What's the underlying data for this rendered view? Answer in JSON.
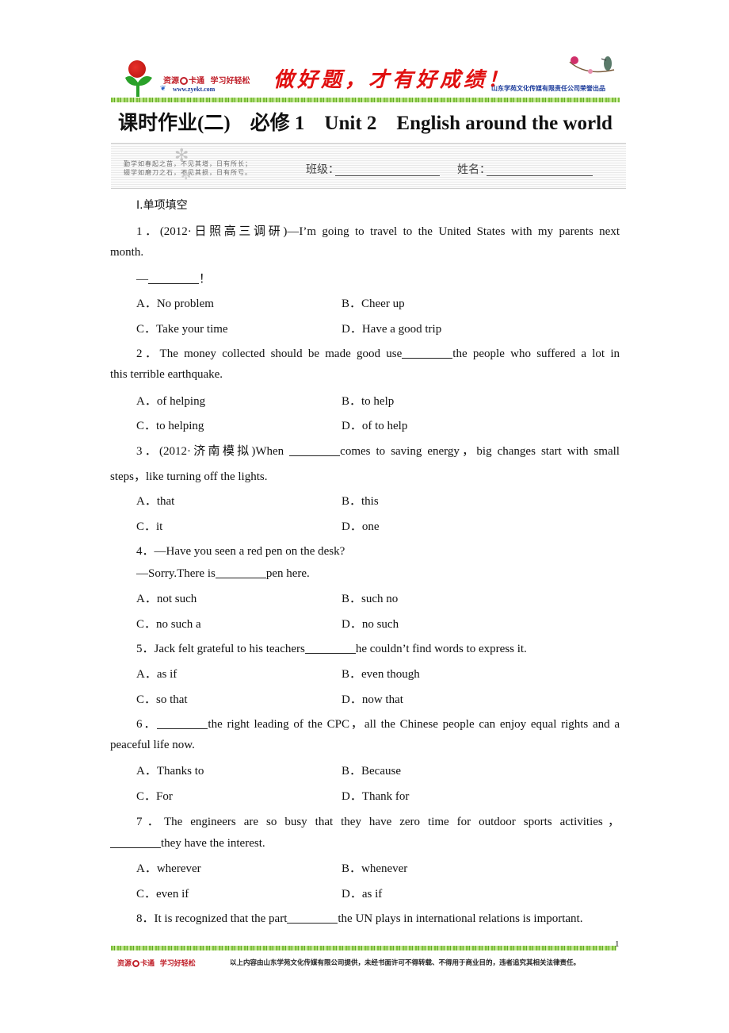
{
  "header": {
    "brand_text_1": "资源",
    "brand_text_2": "卡通",
    "brand_slogan": "学习好轻松",
    "brand_url": "www.zyekt.com",
    "motto": "做好题，才有好成绩！",
    "publisher": "山东学苑文化传媒有限责任公司荣誉出品",
    "accent_red": "#e01010",
    "brand_blue": "#1a3a9a"
  },
  "title": "课时作业(二)　必修 1　Unit 2　English around the world",
  "strip": {
    "motto_lines": [
      "勤学如春起之苗，不见其增，日有所长；",
      "辍学如磨刀之石，不见其损，日有所亏。"
    ],
    "class_label": "班级：",
    "name_label": "姓名："
  },
  "section": {
    "heading": "Ⅰ.单项填空"
  },
  "questions": [
    {
      "number": "1．",
      "stem_line1": "(2012·日照高三调研)—I’m going to travel to the United States with my parents next",
      "stem_line2": "month.",
      "reply_prefix": "—",
      "reply_suffix": "！",
      "options": [
        "A．No problem",
        "B．Cheer up",
        "C．Take your time",
        "D．Have a good trip"
      ]
    },
    {
      "number": "2．",
      "stem_before": "The money collected should be made good use",
      "stem_after": "the people who suffered a lot in",
      "stem_line2": "this terrible earthquake.",
      "options": [
        "A．of helping",
        "B．to help",
        "C．to helping",
        "D．of to help"
      ]
    },
    {
      "number": "3．",
      "stem_before": "(2012·济南模拟)When ",
      "stem_after": "comes to saving energy，big changes start with small",
      "stem_line2": "steps，like turning off the lights.",
      "options": [
        "A．that",
        "B．this",
        "C．it",
        "D．one"
      ]
    },
    {
      "number": "4．",
      "stem_line1": "—Have you seen a red pen on the desk?",
      "reply_before": "—Sorry.There is",
      "reply_after": "pen here.",
      "options": [
        "A．not such",
        "B．such no",
        "C．no such a",
        "D．no such"
      ]
    },
    {
      "number": "5．",
      "stem_before": "Jack felt grateful to his teachers",
      "stem_after": "he couldn’t find words to express it.",
      "options": [
        "A．as if",
        "B．even though",
        "C．so that",
        "D．now that"
      ]
    },
    {
      "number": "6．",
      "stem_after": "the right leading of the CPC，all the Chinese people can enjoy equal rights and a",
      "stem_line2": "peaceful life now.",
      "options": [
        "A．Thanks to",
        "B．Because",
        "C．For",
        "D．Thank for"
      ]
    },
    {
      "number": "7．",
      "stem_line1": "The engineers are so busy that they have zero time for outdoor sports activities，",
      "stem_line2_after": "they have the interest.",
      "options": [
        "A．wherever",
        "B．whenever",
        "C．even if",
        "D．as if"
      ]
    },
    {
      "number": "8．",
      "stem_before": "It is recognized that the part",
      "stem_after": "the UN plays in international relations is important."
    }
  ],
  "footer": {
    "page_number": "1",
    "brand_text_1": "资源",
    "brand_text_2": "卡通",
    "brand_slogan": "学习好轻松",
    "notice": "以上内容由山东学苑文化传媒有限公司提供，未经书面许可不得转载、不得用于商业目的，违者追究其相关法律责任。"
  }
}
